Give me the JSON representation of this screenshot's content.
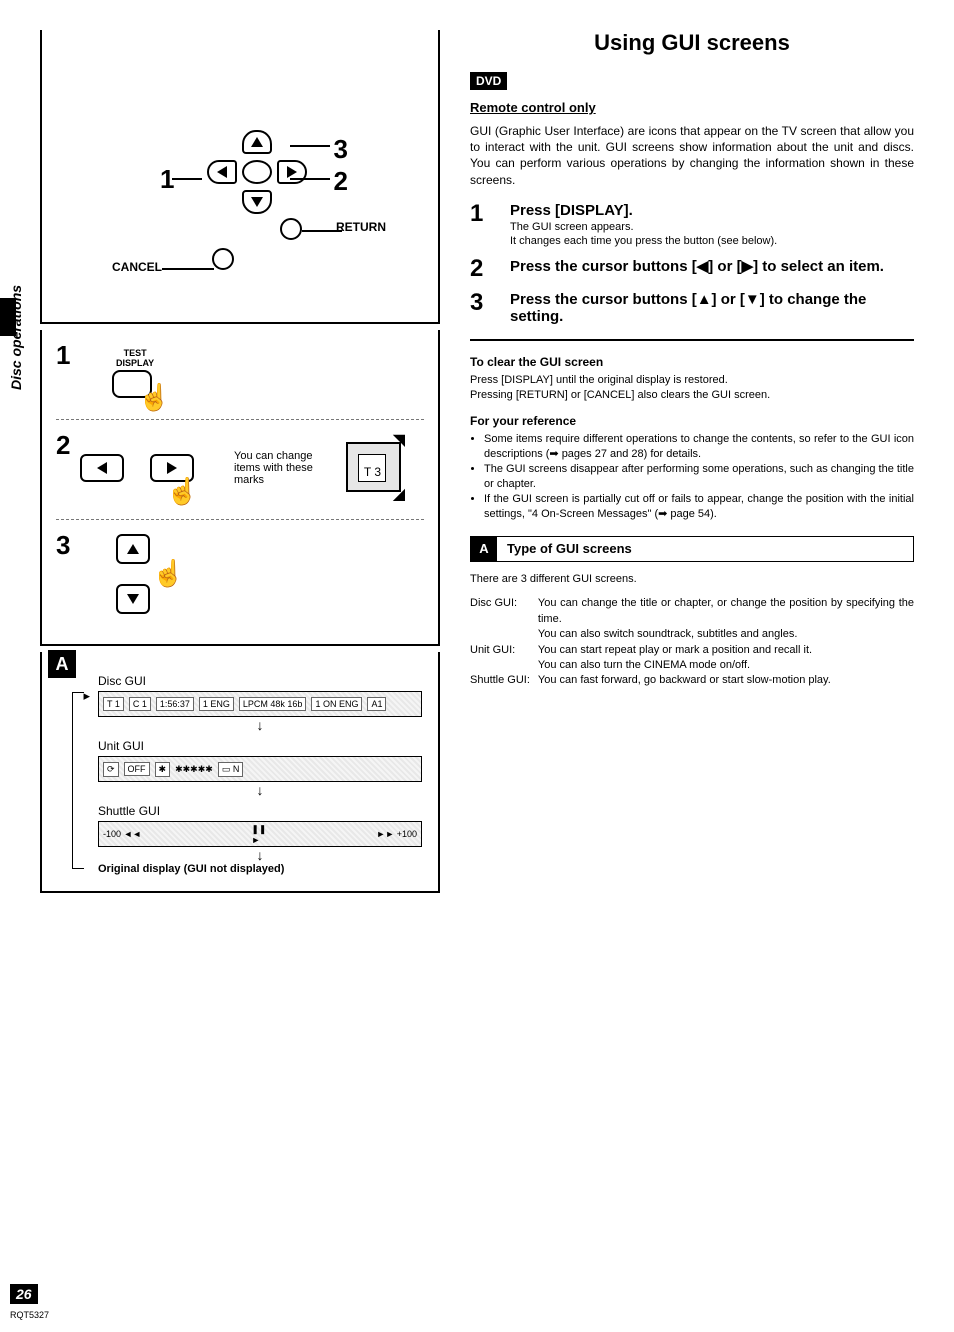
{
  "side": {
    "label": "Disc operations"
  },
  "left": {
    "remote": {
      "n1": "1",
      "n2": "2",
      "n3": "3",
      "return": "RETURN",
      "cancel": "CANCEL"
    },
    "steps": {
      "s1": {
        "num": "1",
        "label": "TEST\nDISPLAY"
      },
      "s2": {
        "num": "2",
        "note": "You can change items with these marks",
        "box_num": "3"
      },
      "s3": {
        "num": "3"
      }
    },
    "guiA": {
      "letter": "A",
      "disc_label": "Disc GUI",
      "disc_bar": {
        "t": "T 1",
        "c": "C 1",
        "time": "1:56:37",
        "a": "1 ENG",
        "lpcm": "LPCM 48k 16b",
        "sub": "1 ON ENG",
        "angle": "A1"
      },
      "unit_label": "Unit GUI",
      "unit_bar": {
        "off": "OFF",
        "stars": "✱✱✱✱✱",
        "n": "N"
      },
      "shuttle_label": "Shuttle GUI",
      "shuttle_bar": {
        "rew": "-100 ◄◄",
        "pause": "❚❚",
        "play_small": "►",
        "ff": "►► +100"
      },
      "original": "Original display (GUI not displayed)"
    }
  },
  "right": {
    "title": "Using GUI screens",
    "dvd": "DVD",
    "remote_only": "Remote control only",
    "intro": "GUI (Graphic User Interface) are icons that appear on the TV screen that allow you to interact with the unit. GUI screens show information about the unit and discs. You can perform various operations by changing the information shown in these screens.",
    "steps": [
      {
        "num": "1",
        "title": "Press [DISPLAY].",
        "sub1": "The GUI screen appears.",
        "sub2": "It changes each time you press the button (see below)."
      },
      {
        "num": "2",
        "title": "Press the cursor buttons [◀] or [▶] to select an item."
      },
      {
        "num": "3",
        "title": "Press the cursor buttons [▲] or [▼] to change the setting."
      }
    ],
    "clear_head": "To clear the GUI screen",
    "clear_body1": "Press [DISPLAY] until the original display is restored.",
    "clear_body2": "Pressing [RETURN] or [CANCEL] also clears the GUI screen.",
    "ref_head": "For your reference",
    "ref_items": [
      "Some items require different operations to change the contents, so refer to the GUI icon descriptions (➡ pages 27 and 28) for details.",
      "The GUI screens disappear after performing some operations, such as changing the title or chapter.",
      "If the GUI screen is partially cut off or fails to appear, change the position with the initial settings, \"4 On-Screen Messages\" (➡ page 54)."
    ],
    "sectionA": {
      "letter": "A",
      "title": "Type of GUI screens"
    },
    "types_intro": "There are 3 different GUI screens.",
    "types": [
      {
        "term": "Disc GUI:",
        "desc": "You can change the title or chapter, or change the position by specifying the time.\nYou can also switch soundtrack, subtitles and angles."
      },
      {
        "term": "Unit GUI:",
        "desc": "You can start repeat play or mark a position and recall it.\nYou can also turn the CINEMA mode on/off."
      },
      {
        "term": "Shuttle GUI:",
        "desc": "You can fast forward, go backward or start slow-motion play."
      }
    ]
  },
  "page": {
    "num": "26",
    "code": "RQT5327"
  }
}
